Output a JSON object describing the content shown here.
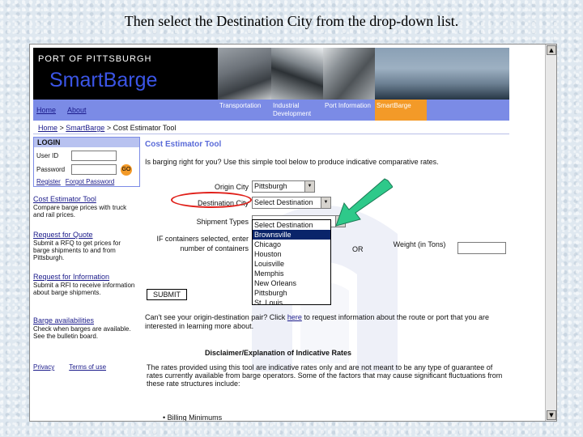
{
  "caption": "Then select the Destination City from the drop-down list.",
  "header": {
    "port_label": "PORT OF PITTSBURGH",
    "brand": "SmartBarge"
  },
  "nav": {
    "home": "Home",
    "about": "About"
  },
  "tabs": [
    {
      "label": "Transportation"
    },
    {
      "label": "Industrial Development"
    },
    {
      "label": "Port Information"
    },
    {
      "label": "SmartBarge"
    }
  ],
  "breadcrumb": {
    "home": "Home",
    "sep1": " > ",
    "smartbarge": "SmartBarge",
    "sep2": " > ",
    "current": "Cost Estimator Tool"
  },
  "login": {
    "title": "LOGIN",
    "user_label": "User ID",
    "password_label": "Password",
    "go": "GO",
    "register": "Register",
    "forgot": "Forgot Password"
  },
  "sidebar": {
    "items": [
      {
        "label": "Cost Estimator Tool",
        "desc": "Compare barge prices with truck and rail prices."
      },
      {
        "label": "Request for Quote",
        "desc": "Submit a RFQ to get prices for barge shipments to and from Pittsburgh."
      },
      {
        "label": "Request for Information",
        "desc": "Submit a RFI to receive information about barge shipments."
      },
      {
        "label": "Barge availabilities",
        "desc": "Check when barges are available. See the bulletin board."
      }
    ],
    "privacy": "Privacy",
    "terms": "Terms of use"
  },
  "main": {
    "title": "Cost Estimator Tool",
    "intro": "Is barging right for you? Use this simple tool below to produce indicative comparative rates.",
    "origin_label": "Origin City",
    "origin_value": "Pittsburgh",
    "destination_label": "Destination City",
    "destination_value": "Select Destination",
    "shipment_label": "Shipment Types",
    "containers_label": "IF containers selected, enter number of containers",
    "or": "OR",
    "weight_label": "Weight (in Tons)",
    "submit": "SUBMIT",
    "cant_see_pre": "Can't see your origin-destination pair? Click ",
    "cant_see_link": "here",
    "cant_see_post": " to request information about the route or port that you are interested in learning more about.",
    "disclaimer_title": "Disclaimer/Explanation of Indicative Rates",
    "disclaimer_text": "The rates provided using this tool are indicative rates only and are not meant to be any type of guarantee of rates currently available from barge operators. Some of the factors that may cause significant fluctuations from these rate structures include:",
    "bullet": "Billing Minimums"
  },
  "dropdown": {
    "options": [
      "Select Destination",
      "Brownsville",
      "Chicago",
      "Houston",
      "Louisville",
      "Memphis",
      "New Orleans",
      "Pittsburgh",
      "St. Louis"
    ],
    "highlighted": "Brownsville"
  },
  "colors": {
    "nav_blue": "#7b8be6",
    "smartbarge_orange": "#f39a28",
    "brand_blue": "#3b55e6",
    "annotation_red": "#e0201a",
    "annotation_arrow": "#2ec98a"
  }
}
